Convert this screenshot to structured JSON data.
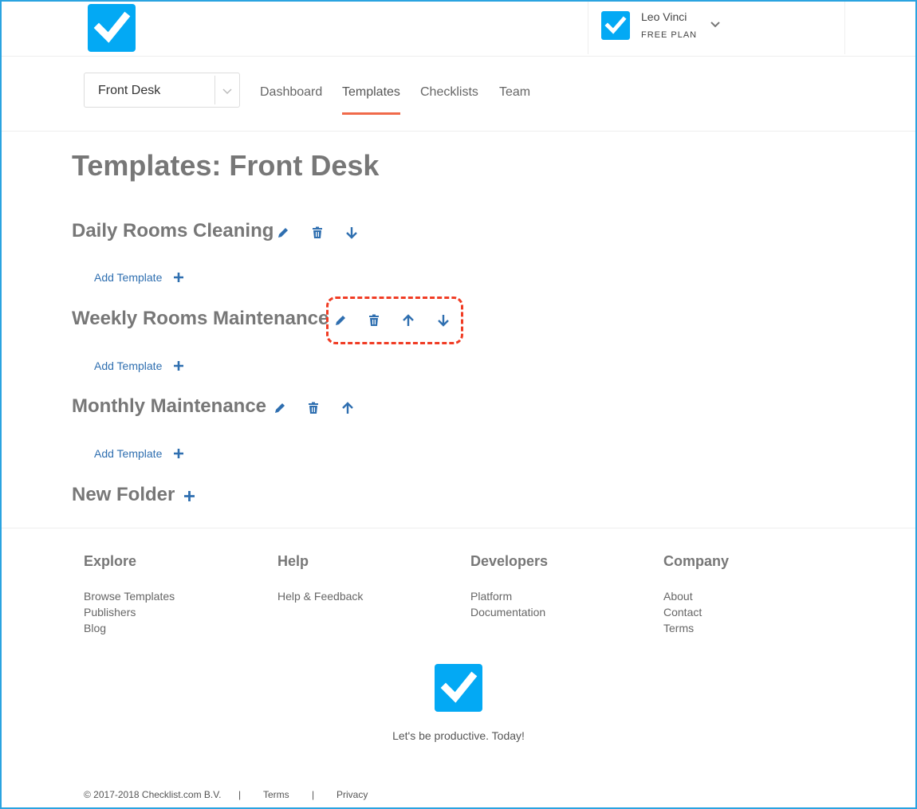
{
  "header": {
    "user_name": "Leo Vinci",
    "user_plan": "FREE PLAN"
  },
  "nav": {
    "team_select_value": "Front Desk",
    "tabs": [
      {
        "label": "Dashboard"
      },
      {
        "label": "Templates",
        "active": true
      },
      {
        "label": "Checklists"
      },
      {
        "label": "Team"
      }
    ]
  },
  "main": {
    "page_title": "Templates: Front Desk",
    "folders": [
      {
        "title": "Daily Rooms Cleaning",
        "add_label": "Add Template"
      },
      {
        "title": "Weekly Rooms Maintenance",
        "add_label": "Add Template"
      },
      {
        "title": "Monthly Maintenance",
        "add_label": "Add Template"
      }
    ],
    "new_folder_label": "New Folder"
  },
  "footer": {
    "columns": [
      {
        "heading": "Explore",
        "links": [
          "Browse Templates",
          "Publishers",
          "Blog"
        ]
      },
      {
        "heading": "Help",
        "links": [
          "Help & Feedback"
        ]
      },
      {
        "heading": "Developers",
        "links": [
          "Platform",
          "Documentation"
        ]
      },
      {
        "heading": "Company",
        "links": [
          "About",
          "Contact",
          "Terms"
        ]
      }
    ],
    "tagline": "Let's be productive. Today!",
    "copyright": "© 2017-2018 Checklist.com B.V.",
    "separator": "|",
    "terms": "Terms",
    "privacy": "Privacy"
  },
  "colors": {
    "brand_blue": "#03a9f4",
    "action_blue": "#2f6fb0",
    "active_tab_underline": "#f06a4a",
    "highlight_red": "#f03c24"
  },
  "icons": [
    "checkmark-logo-icon",
    "chevron-down-icon",
    "pencil-icon",
    "trash-icon",
    "arrow-up-icon",
    "arrow-down-icon",
    "plus-icon"
  ]
}
